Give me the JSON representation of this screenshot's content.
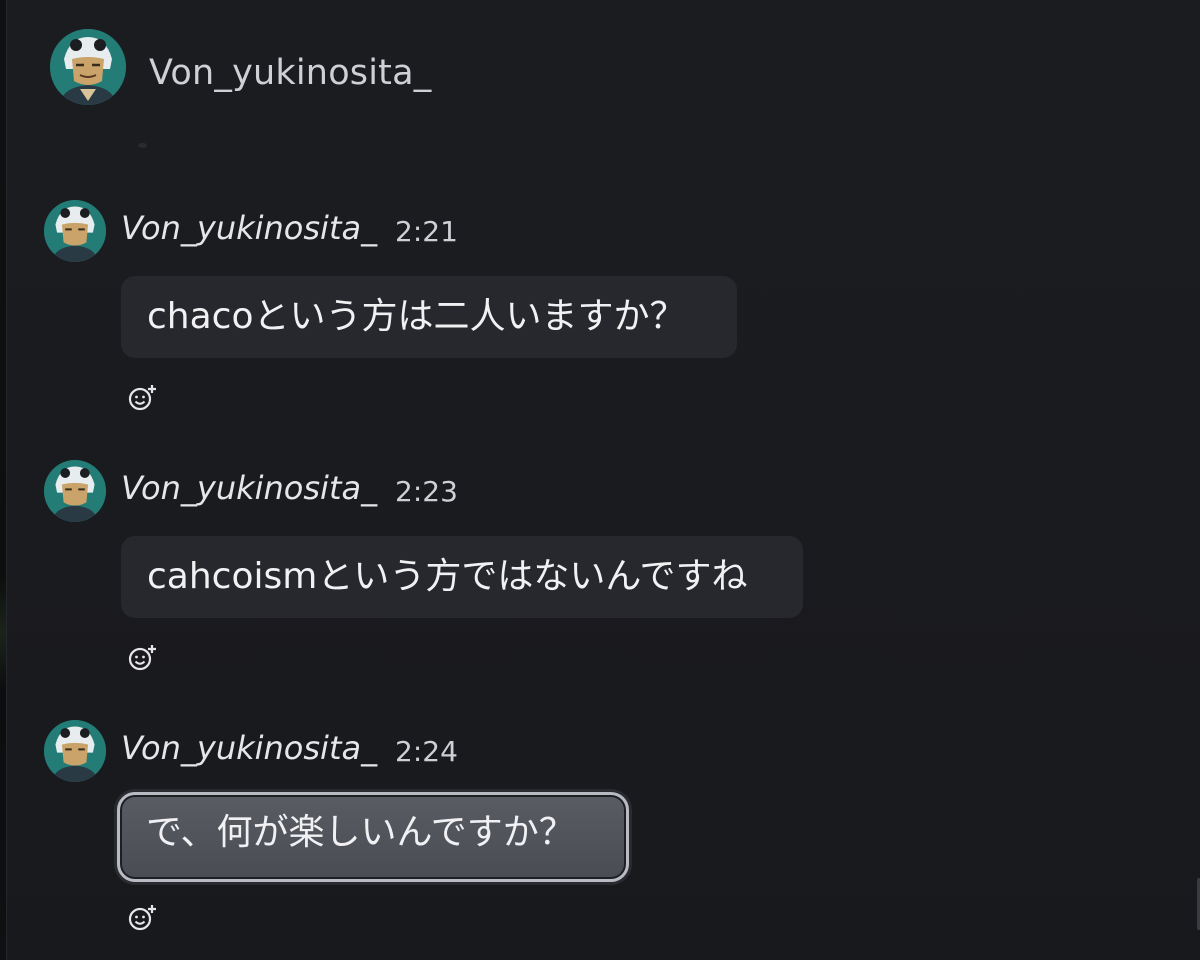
{
  "header": {
    "name": "Von_yukinosita_",
    "avatar_icon": "user-avatar-icon"
  },
  "messages": [
    {
      "author": "Von_yukinosita_",
      "time": "2:21",
      "text": "chacoという方は二人いますか？",
      "selected": false
    },
    {
      "author": "Von_yukinosita_",
      "time": "2:23",
      "text": "cahcoismという方ではないんですね",
      "selected": false
    },
    {
      "author": "Von_yukinosita_",
      "time": "2:24",
      "text": "で、何が楽しいんですか？",
      "selected": true
    }
  ],
  "icons": {
    "reaction": "add-reaction-icon",
    "avatar": "user-avatar-icon"
  },
  "colors": {
    "background": "#1b1c20",
    "bubble": "#27282d",
    "bubble_selected": "#54565e",
    "avatar_accent": "#2c8f86"
  }
}
